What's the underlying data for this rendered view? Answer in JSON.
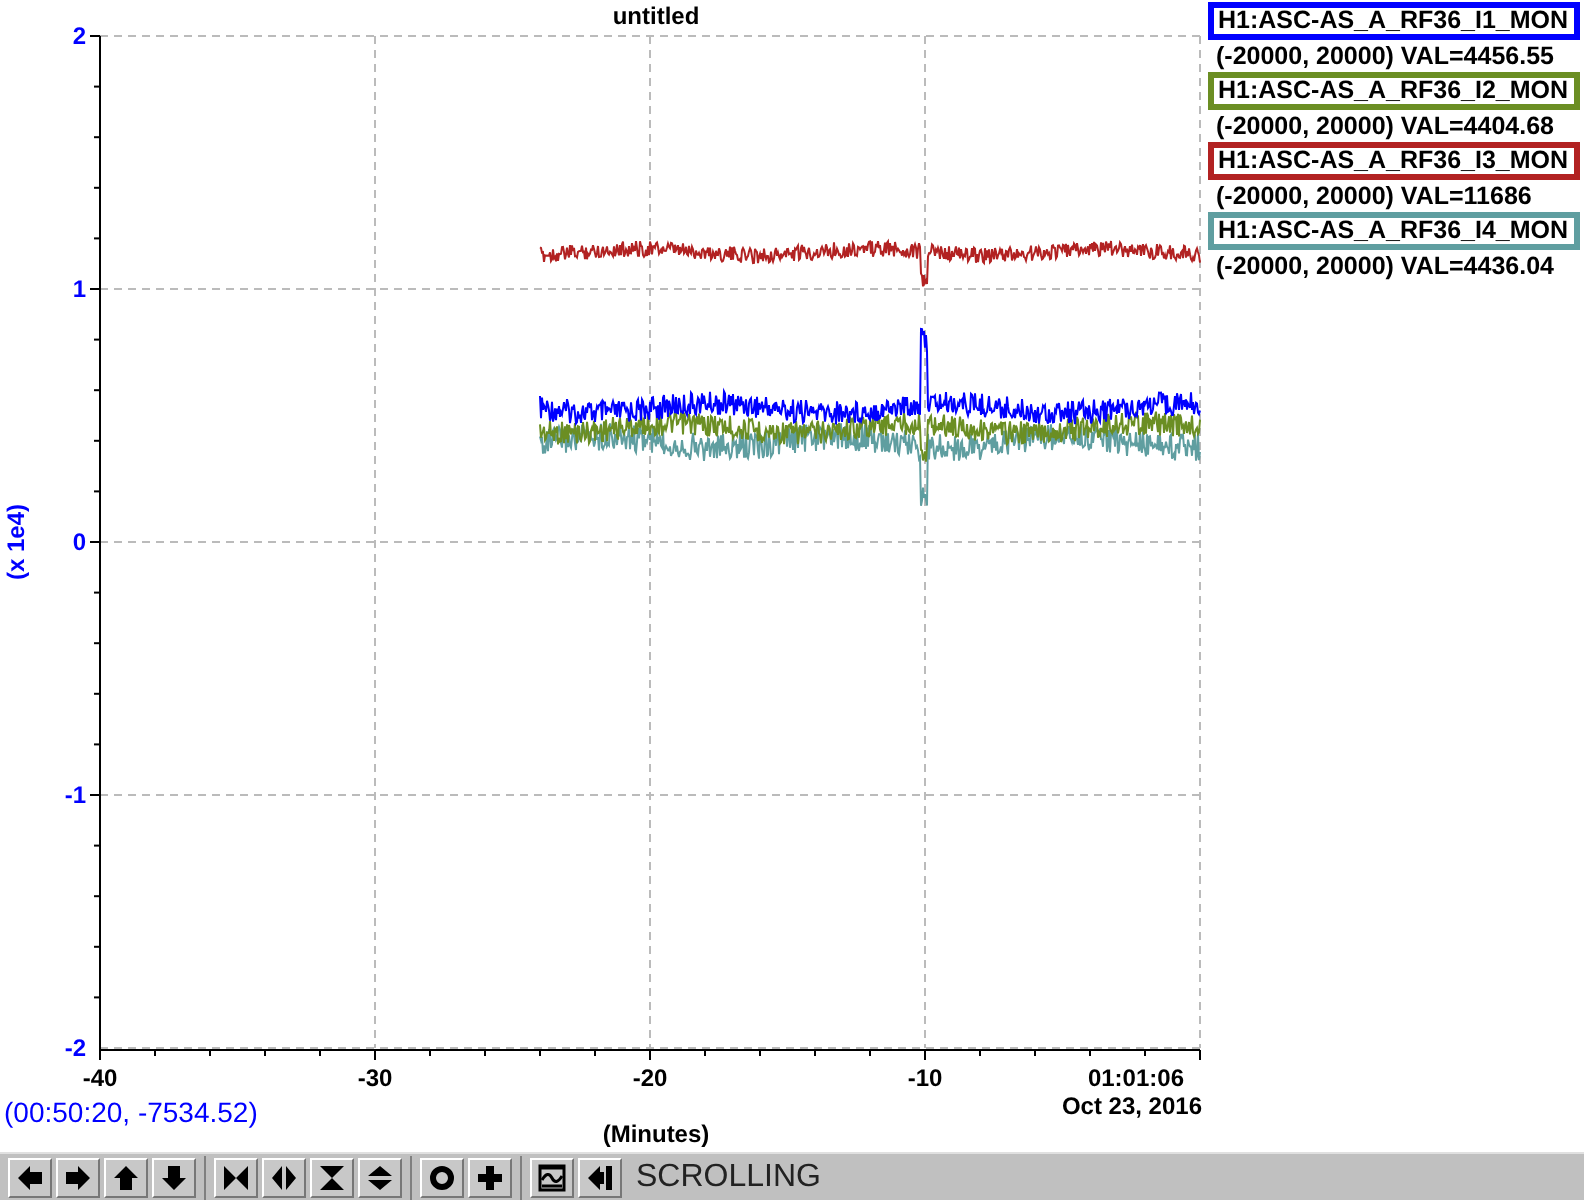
{
  "plot": {
    "title": "untitled",
    "y_axis": {
      "label": "(x 1e4)",
      "ticks": [
        "2",
        "1",
        "0",
        "-1",
        "-2"
      ]
    },
    "x_axis": {
      "label": "(Minutes)",
      "ticks": [
        "-40",
        "-30",
        "-20",
        "-10"
      ],
      "end_time": "01:01:06",
      "end_date": "Oct 23, 2016"
    },
    "cursor_readout": "(00:50:20, -7534.52)"
  },
  "legend": [
    {
      "name": "H1:ASC-AS_A_RF36_I1_MON",
      "range_value": "(-20000, 20000) VAL=4456.55",
      "color": "#0000ff"
    },
    {
      "name": "H1:ASC-AS_A_RF36_I2_MON",
      "range_value": "(-20000, 20000) VAL=4404.68",
      "color": "#6b8e23"
    },
    {
      "name": "H1:ASC-AS_A_RF36_I3_MON",
      "range_value": "(-20000, 20000) VAL=11686",
      "color": "#b22222"
    },
    {
      "name": "H1:ASC-AS_A_RF36_I4_MON",
      "range_value": "(-20000, 20000) VAL=4436.04",
      "color": "#5f9ea0"
    }
  ],
  "toolbar": {
    "mode": "SCROLLING"
  }
}
